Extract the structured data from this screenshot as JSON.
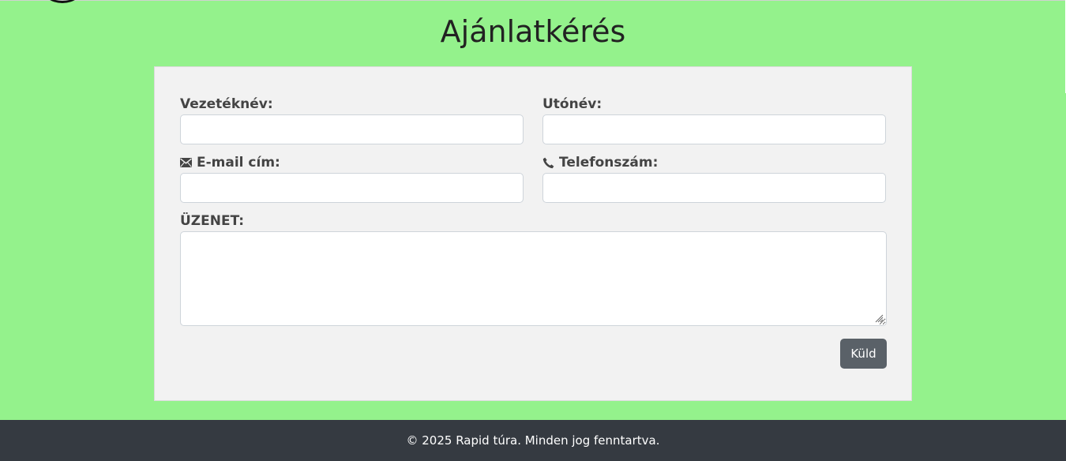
{
  "page": {
    "title": "Ajánlatkérés"
  },
  "form": {
    "last_name_label": "Vezetéknév:",
    "first_name_label": "Utónév:",
    "email_label": "E-mail cím:",
    "email_icon": "envelope-icon",
    "phone_label": "Telefonszám:",
    "phone_icon": "phone-icon",
    "message_label": "ÜZENET:",
    "last_name_value": "",
    "first_name_value": "",
    "email_value": "",
    "phone_value": "",
    "message_value": "",
    "submit_label": "Küld"
  },
  "footer": {
    "text": "© 2025 Rapid túra. Minden jog fenntartva."
  },
  "colors": {
    "page_background": "#94f28c",
    "card_background": "#f2f2f2",
    "button_background": "#5a6168",
    "footer_background": "#353a41"
  }
}
